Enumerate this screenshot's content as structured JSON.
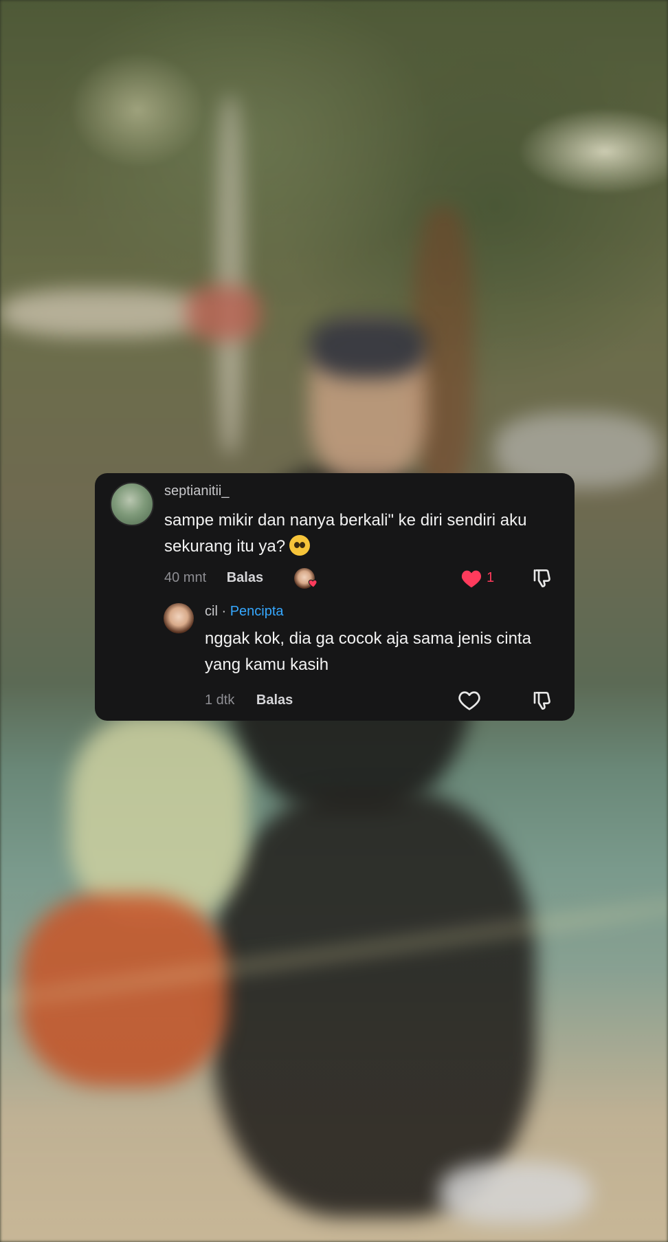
{
  "comment": {
    "username": "septianitii_",
    "text": "sampe mikir dan nanya berkali\" ke diri sendiri aku sekurang itu ya?",
    "emoji": "pleading-face",
    "time": "40 mnt",
    "reply_label": "Balas",
    "like_count": "1",
    "liked": true
  },
  "reply": {
    "username": "cil",
    "separator": "·",
    "badge": "Pencipta",
    "text": "nggak kok, dia ga cocok aja sama jenis cinta yang kamu kasih",
    "time": "1 dtk",
    "reply_label": "Balas"
  },
  "colors": {
    "card_bg": "#161617",
    "like_red": "#ff3b5c",
    "creator_blue": "#36a8ff"
  }
}
